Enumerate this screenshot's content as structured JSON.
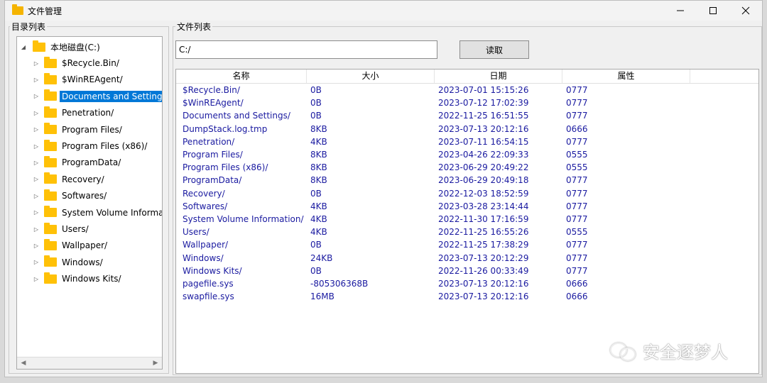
{
  "window": {
    "title": "文件管理"
  },
  "controls": {
    "minimize": "—",
    "maximize": "□",
    "close": "✕"
  },
  "tree_group": {
    "label": "目录列表"
  },
  "list_group": {
    "label": "文件列表"
  },
  "tree": {
    "root": "本地磁盘(C:)",
    "items": [
      "$Recycle.Bin/",
      "$WinREAgent/",
      "Documents and Settings/",
      "Penetration/",
      "Program Files/",
      "Program Files (x86)/",
      "ProgramData/",
      "Recovery/",
      "Softwares/",
      "System Volume Information/",
      "Users/",
      "Wallpaper/",
      "Windows/",
      "Windows Kits/"
    ],
    "selected_index": 2
  },
  "path": {
    "value": "C:/"
  },
  "read_button": {
    "label": "读取"
  },
  "table": {
    "columns": [
      "名称",
      "大小",
      "日期",
      "属性"
    ],
    "rows": [
      [
        "$Recycle.Bin/",
        "0B",
        "2023-07-01 15:15:26",
        "0777"
      ],
      [
        "$WinREAgent/",
        "0B",
        "2023-07-12 17:02:39",
        "0777"
      ],
      [
        "Documents and Settings/",
        "0B",
        "2022-11-25 16:51:55",
        "0777"
      ],
      [
        "DumpStack.log.tmp",
        "8KB",
        "2023-07-13 20:12:16",
        "0666"
      ],
      [
        "Penetration/",
        "4KB",
        "2023-07-11 16:54:15",
        "0777"
      ],
      [
        "Program Files/",
        "8KB",
        "2023-04-26 22:09:33",
        "0555"
      ],
      [
        "Program Files (x86)/",
        "8KB",
        "2023-06-29 20:49:22",
        "0555"
      ],
      [
        "ProgramData/",
        "8KB",
        "2023-06-29 20:49:18",
        "0777"
      ],
      [
        "Recovery/",
        "0B",
        "2022-12-03 18:52:59",
        "0777"
      ],
      [
        "Softwares/",
        "4KB",
        "2023-03-28 23:14:44",
        "0777"
      ],
      [
        "System Volume Information/",
        "4KB",
        "2022-11-30 17:16:59",
        "0777"
      ],
      [
        "Users/",
        "4KB",
        "2022-11-25 16:55:26",
        "0555"
      ],
      [
        "Wallpaper/",
        "0B",
        "2022-11-25 17:38:29",
        "0777"
      ],
      [
        "Windows/",
        "24KB",
        "2023-07-13 20:12:29",
        "0777"
      ],
      [
        "Windows Kits/",
        "0B",
        "2022-11-26 00:33:49",
        "0777"
      ],
      [
        "pagefile.sys",
        "-805306368B",
        "2023-07-13 20:12:16",
        "0666"
      ],
      [
        "swapfile.sys",
        "16MB",
        "2023-07-13 20:12:16",
        "0666"
      ]
    ]
  },
  "watermark": {
    "text": "安全逐梦人"
  },
  "colors": {
    "selection": "#0078d7",
    "row_text": "#1a1aa0",
    "folder": "#ffc107"
  }
}
